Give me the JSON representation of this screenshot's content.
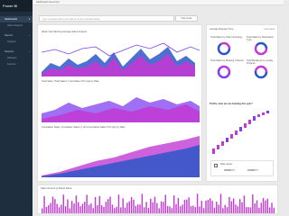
{
  "app": {
    "title": "Power BI"
  },
  "sidebar": {
    "items": [
      {
        "label": "Dashboards",
        "active": true
      },
      {
        "label": "Sales Analysis",
        "sub": true
      },
      {
        "label": "Reports"
      },
      {
        "label": "Analysis"
      },
      {
        "label": "Datasets"
      },
      {
        "label": "Datasets"
      },
      {
        "label": "Sources"
      }
    ]
  },
  "topbar": {
    "title": "Dashboard name here"
  },
  "qa": {
    "placeholder": "Type a question about your data or use the examples below",
    "button": "How to ask"
  },
  "panels": {
    "main": {
      "chart1_title": "Week Year Morning Average Sales Analysis",
      "chart2_title": "Total Sales, Total Sales LY and Sales 3Yrs Ago by Date",
      "chart3_title": "Cumulative Sales, Cumulative Sales LY and Cumulative Sales 3Yrs Ago by Date"
    },
    "right": {
      "title": "Average Request Time",
      "link": "Last week",
      "donut_labels": [
        "Total Sales by Client Grouping",
        "Total Sales by Destination Type",
        "Total Sales by Booking Channel",
        "Total Bookings by Loyalty Program"
      ],
      "profit_title": "Profits, How are we tracking this year?",
      "date_range_label": "Date range",
      "date_from": "DD/MM/YY",
      "date_to": "DD/MM/YY"
    },
    "bottom": {
      "title": "Sales Amount by Brand Name"
    }
  },
  "legend_colors": {
    "a": "#2b57c8",
    "b": "#c23ad3",
    "c": "#7f3ff0"
  }
}
